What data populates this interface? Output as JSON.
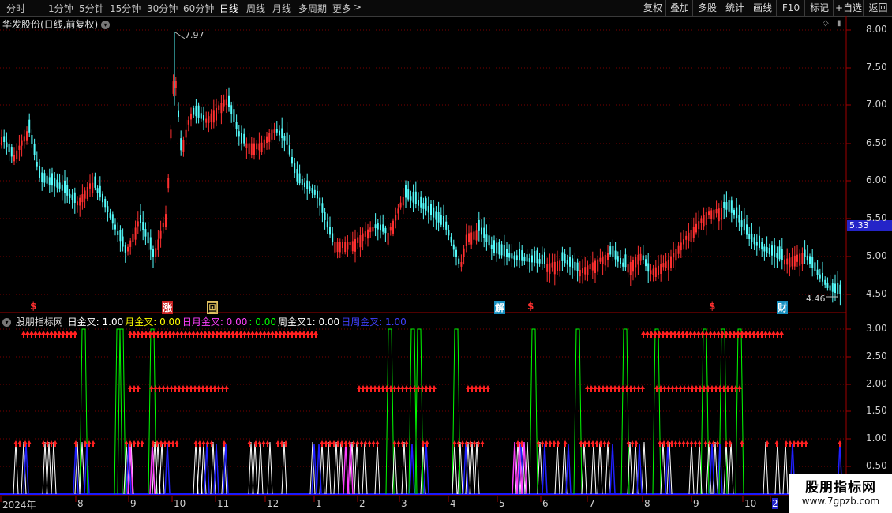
{
  "toolbar": {
    "tabs": [
      {
        "label": "分时",
        "active": false
      },
      {
        "label": "1分钟",
        "active": false
      },
      {
        "label": "5分钟",
        "active": false
      },
      {
        "label": "15分钟",
        "active": false
      },
      {
        "label": "30分钟",
        "active": false
      },
      {
        "label": "60分钟",
        "active": false
      },
      {
        "label": "日线",
        "active": true
      },
      {
        "label": "周线",
        "active": false
      },
      {
        "label": "月线",
        "active": false
      },
      {
        "label": "多周期",
        "active": false
      },
      {
        "label": "更多",
        "active": false
      }
    ],
    "right_buttons": [
      "复权",
      "叠加",
      "多股",
      "统计",
      "画线",
      "F10",
      "标记",
      "+自选",
      "返回"
    ]
  },
  "stock": {
    "title": "华发股份(日线,前复权)",
    "high_label": "7.97",
    "low_label": "4.46",
    "current_price": "5.33"
  },
  "price_axis": [
    "8.00",
    "7.50",
    "7.00",
    "6.50",
    "6.00",
    "5.50",
    "5.00",
    "4.50"
  ],
  "indicator_axis": [
    "3.00",
    "2.50",
    "2.00",
    "1.50",
    "1.00",
    "0.50"
  ],
  "signal_marks": [
    "$",
    "涨",
    "回",
    "解",
    "$",
    "$",
    "财"
  ],
  "indicator": {
    "name": "股朋指标网",
    "items": [
      {
        "label": "日金叉: 1.00",
        "color": "#ffffff"
      },
      {
        "label": "月金叉: 0.00",
        "color": "#ffff00"
      },
      {
        "label": "日月金叉: 0.00",
        "color": "#ff40ff"
      },
      {
        "label": ": 0.00",
        "color": "#00ff00"
      },
      {
        "label": "周金叉1: 0.00",
        "color": "#ffffff"
      },
      {
        "label": "日周金叉: 1.00",
        "color": "#4040ff"
      }
    ]
  },
  "time_axis": [
    "2024年",
    "8",
    "9",
    "10",
    "11",
    "12",
    "1",
    "2",
    "3",
    "4",
    "5",
    "6",
    "7",
    "8",
    "9",
    "10",
    "2"
  ],
  "watermark": {
    "title": "股朋指标网",
    "url": "www.7gpzb.com"
  },
  "colors": {
    "up": "#ff3030",
    "down": "#54fcfc",
    "grid": "#7a0000",
    "green": "#00ff00",
    "blue": "#2020ff",
    "magenta": "#ff40ff"
  }
}
